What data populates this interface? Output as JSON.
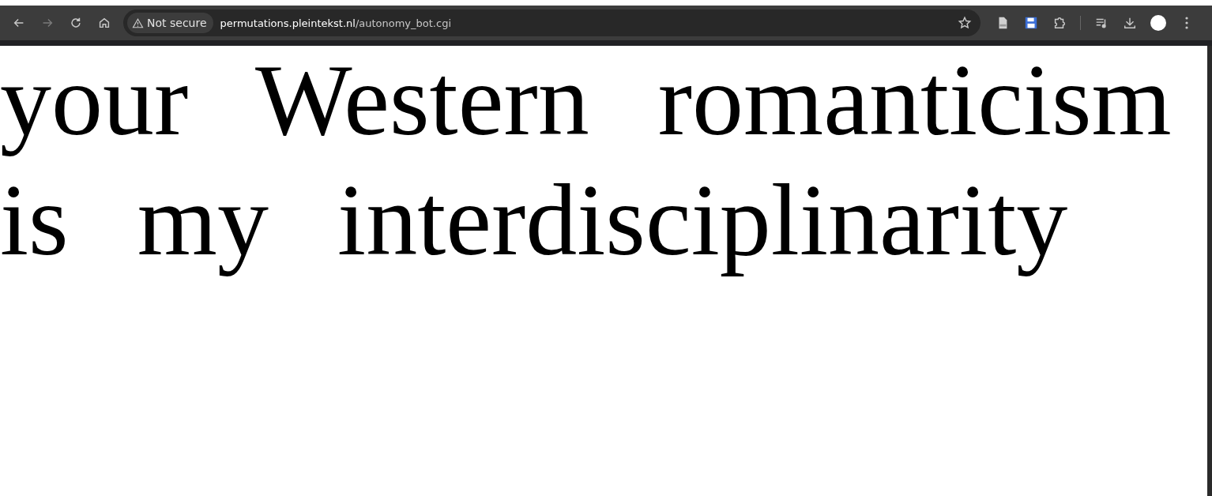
{
  "toolbar": {
    "security_chip": "Not secure",
    "url_host": "permutations.pleintekst.nl",
    "url_path": "/autonomy_bot.cgi",
    "forward_disabled": true
  },
  "page": {
    "text": "your Western romanticism is my interdisciplinarity"
  }
}
